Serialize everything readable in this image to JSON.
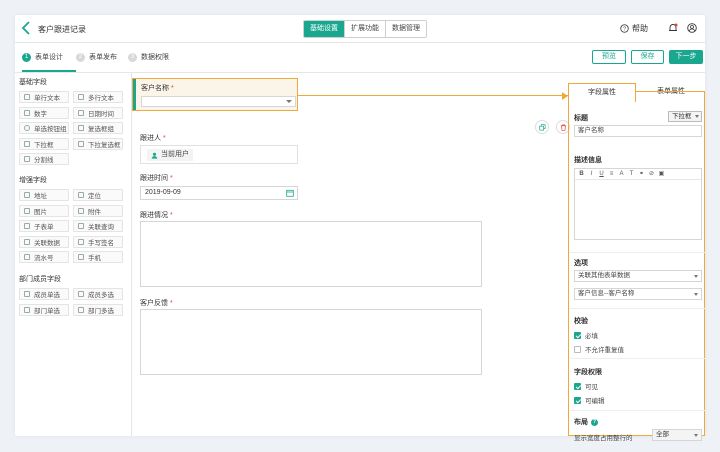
{
  "header": {
    "title": "客户跟进记录",
    "tabs": [
      {
        "label": "基础设置",
        "active": true
      },
      {
        "label": "扩展功能",
        "active": false
      },
      {
        "label": "数据管理",
        "active": false
      }
    ],
    "help_label": "帮助"
  },
  "steps": {
    "items": [
      {
        "num": "1",
        "label": "表单设计",
        "active": true
      },
      {
        "num": "2",
        "label": "表单发布",
        "active": false
      },
      {
        "num": "3",
        "label": "数据权限",
        "active": false
      }
    ],
    "preview_label": "预览",
    "save_label": "保存",
    "next_label": "下一步"
  },
  "palette": {
    "basic_title": "基础字段",
    "basic": [
      "单行文本",
      "多行文本",
      "数字",
      "日期时间",
      "单选按钮组",
      "复选框组",
      "下拉框",
      "下拉复选框",
      "分割线"
    ],
    "advanced_title": "增强字段",
    "advanced": [
      "地址",
      "定位",
      "图片",
      "附件",
      "子表单",
      "关联查询",
      "关联数据",
      "手写签名",
      "流水号",
      "手机"
    ],
    "dept_title": "部门成员字段",
    "dept": [
      "成员单选",
      "成员多选",
      "部门单选",
      "部门多选"
    ]
  },
  "form": {
    "customer_name_label": "客户名称",
    "follower_label": "跟进人",
    "current_user": "当前用户",
    "follow_time_label": "跟进时间",
    "follow_time_value": "2019-09-09",
    "follow_status_label": "跟进情况",
    "feedback_label": "客户反馈"
  },
  "props": {
    "tab_field": "字段属性",
    "tab_form": "表单属性",
    "title_label": "标题",
    "type_value": "下拉框",
    "title_value": "客户名称",
    "desc_label": "描述信息",
    "options_label": "选项",
    "option_source": "关联其他表单数据",
    "option_value": "客户信息--客户名称",
    "validation_label": "校验",
    "required_label": "必填",
    "required_checked": true,
    "no_dup_label": "不允许重复值",
    "no_dup_checked": false,
    "permission_label": "字段权限",
    "visible_label": "可见",
    "visible_checked": true,
    "editable_label": "可编辑",
    "editable_checked": true,
    "layout_label": "布局",
    "layout_text": "显示宽度占用整行的",
    "layout_value": "全部"
  },
  "colors": {
    "accent": "#1aa78f",
    "highlight": "#f0a83c",
    "required": "#e0453a",
    "delete": "#e0453a"
  }
}
